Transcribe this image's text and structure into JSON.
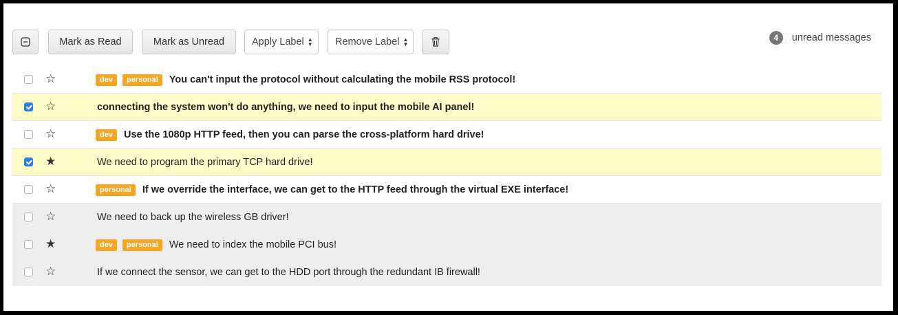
{
  "toolbar": {
    "select_all_icon": "minus-square-icon",
    "mark_read_label": "Mark as Read",
    "mark_unread_label": "Mark as Unread",
    "apply_label": "Apply Label",
    "remove_label": "Remove Label",
    "delete_icon": "trash-icon",
    "unread_count": "4",
    "unread_text": "unread messages"
  },
  "messages": [
    {
      "selected": false,
      "starred": false,
      "read": false,
      "labels": [
        "dev",
        "personal"
      ],
      "subject": "You can't input the protocol without calculating the mobile RSS protocol!"
    },
    {
      "selected": true,
      "starred": false,
      "read": false,
      "labels": [],
      "subject": "connecting the system won't do anything, we need to input the mobile AI panel!"
    },
    {
      "selected": false,
      "starred": false,
      "read": false,
      "labels": [
        "dev"
      ],
      "subject": "Use the 1080p HTTP feed, then you can parse the cross-platform hard drive!"
    },
    {
      "selected": true,
      "starred": true,
      "read": true,
      "labels": [],
      "subject": "We need to program the primary TCP hard drive!"
    },
    {
      "selected": false,
      "starred": false,
      "read": false,
      "labels": [
        "personal"
      ],
      "subject": "If we override the interface, we can get to the HTTP feed through the virtual EXE interface!"
    },
    {
      "selected": false,
      "starred": false,
      "read": true,
      "labels": [],
      "subject": "We need to back up the wireless GB driver!"
    },
    {
      "selected": false,
      "starred": true,
      "read": true,
      "labels": [
        "dev",
        "personal"
      ],
      "subject": "We need to index the mobile PCI bus!"
    },
    {
      "selected": false,
      "starred": false,
      "read": true,
      "labels": [],
      "subject": "If we connect the sensor, we can get to the HDD port through the redundant IB firewall!"
    }
  ],
  "colors": {
    "selected_row": "#fcfcc8",
    "read_row": "#eeeeee",
    "label": "#f5a623",
    "checkbox_checked": "#2f7de1"
  }
}
